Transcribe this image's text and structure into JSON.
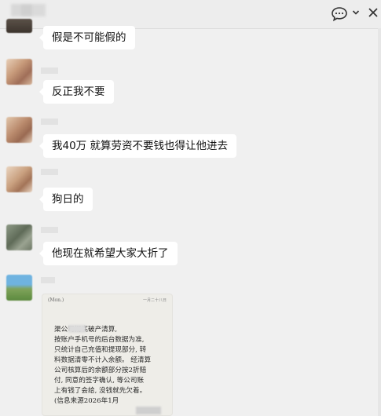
{
  "header": {
    "title": "",
    "chat_icon": "chat-bubble-icon",
    "chevron_icon": "chevron-down-icon",
    "close_icon": "close-icon"
  },
  "messages": [
    {
      "text": "假是不可能假的"
    },
    {
      "text": "反正我不要"
    },
    {
      "text": "我40万 就算劳资不要钱也得让他进去"
    },
    {
      "text": "狗日的"
    },
    {
      "text": "他现在就希望大家大折了"
    }
  ],
  "document": {
    "header_left": "(Mon.)",
    "header_right": "一月二十八日",
    "lines": [
      "      渠公司彻底破产清算,",
      "按账户手机号的后台数据为准,",
      "只统计自己充值和提现部分, 转",
      "料数据清零不计入余额。 经清算",
      "公司核算后的余额部分按2折赔",
      "付, 同意的签字确认, 等公司账",
      "上有钱了会给, 没钱就先欠着。",
      "(信息来源2026年1月"
    ]
  }
}
